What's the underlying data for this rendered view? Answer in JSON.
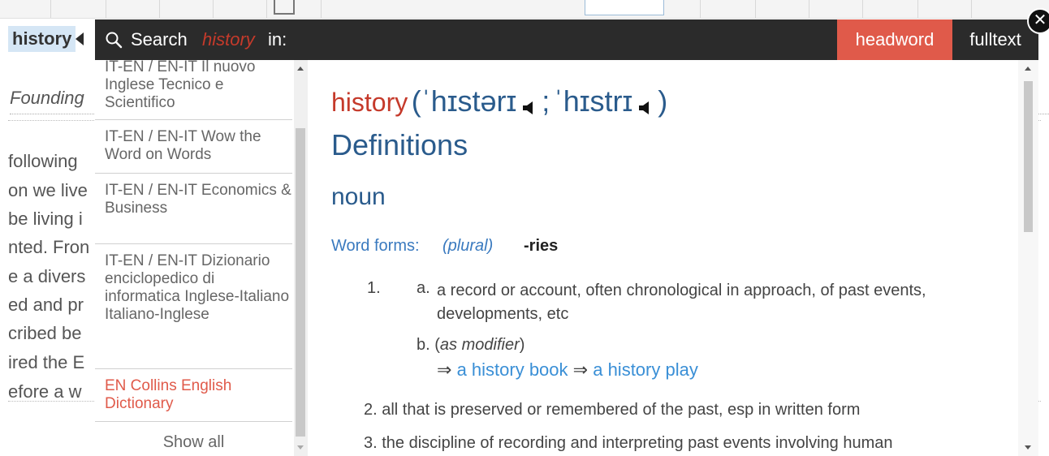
{
  "background_document": {
    "selected_word": "history",
    "subtitle": "Founding",
    "lines": [
      "following",
      "on we live",
      "be living i",
      "nted. Fron",
      "e a divers",
      "ed and pr",
      "cribed be",
      "ired the E",
      "efore a w"
    ]
  },
  "search_bar": {
    "label": "Search",
    "term": "history",
    "suffix": "in:",
    "modes": {
      "headword": "headword",
      "fulltext": "fulltext"
    },
    "active_mode": "headword",
    "active_color": "#e05a4a"
  },
  "dictionaries": [
    {
      "label": "IT-EN / EN-IT Il nuovo Inglese Tecnico e Scientifico",
      "active": false
    },
    {
      "label": "IT-EN / EN-IT Wow the Word on Words",
      "active": false
    },
    {
      "label": "IT-EN / EN-IT Economics & Business",
      "active": false
    },
    {
      "label": "IT-EN / EN-IT Dizionario enciclopedico di informatica Inglese-Italiano Italiano-Inglese",
      "active": false
    },
    {
      "label": "EN Collins English Dictionary",
      "active": true
    }
  ],
  "show_all": "Show all",
  "entry": {
    "headword": "history",
    "open_paren": "(",
    "pron1": "ˈhɪstərɪ",
    "separator": ";",
    "pron2": "ˈhɪstrɪ",
    "close_paren": ")",
    "section": "Definitions",
    "pos": "noun",
    "word_forms_label": "Word forms:",
    "word_forms_plural": "(plural)",
    "word_forms_value": "-ries",
    "sense1_num": "1.",
    "sense1a_label": "a.",
    "sense1a_text": "a record or account, often chronological in approach, of past events, developments, etc",
    "sense1b_label": "b.",
    "sense1b_open": "(",
    "sense1b_mod": "as modifier",
    "sense1b_close": ")",
    "arrow": "⇒",
    "example1": "a history book",
    "example2": "a history play",
    "sense2": "2. all that is preserved or remembered of the past, esp in written form",
    "sense3": "3. the discipline of recording and interpreting past events involving human"
  }
}
